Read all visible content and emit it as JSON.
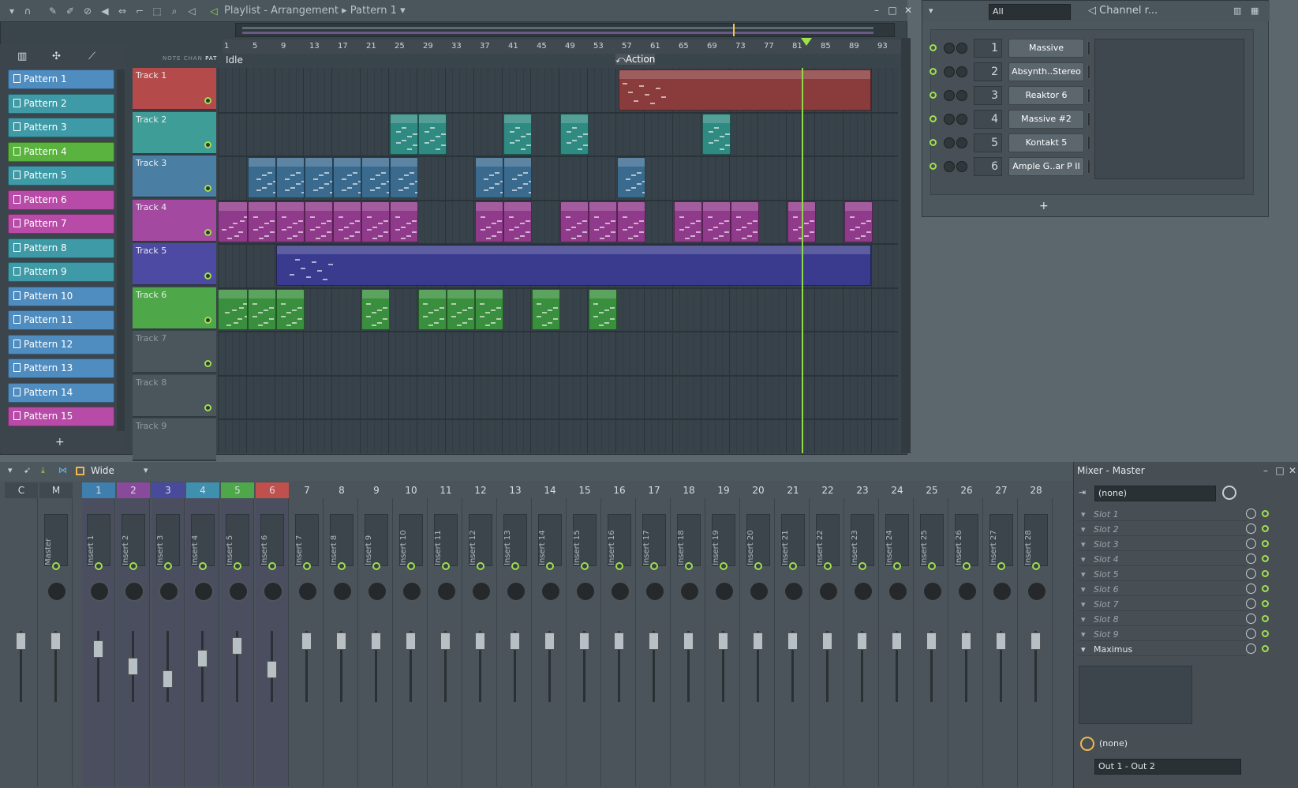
{
  "playlist": {
    "title": "Playlist - Arrangement",
    "pattern_selector": "Pattern 1",
    "status": "Idle",
    "marker": "Action",
    "ruler": [
      "1",
      "5",
      "9",
      "13",
      "17",
      "21",
      "25",
      "29",
      "33",
      "37",
      "41",
      "45",
      "49",
      "53",
      "57",
      "61",
      "65",
      "69",
      "73",
      "77",
      "81",
      "85",
      "89",
      "93"
    ],
    "panel_tabs": [
      "NOTE",
      "CHAN",
      "PAT"
    ],
    "patterns": [
      {
        "label": "Pattern 1",
        "color": "#4f8cc0"
      },
      {
        "label": "Pattern 2",
        "color": "#3d9aa6"
      },
      {
        "label": "Pattern 3",
        "color": "#3d9aa6"
      },
      {
        "label": "Pattern 4",
        "color": "#5ab33e"
      },
      {
        "label": "Pattern 5",
        "color": "#3d9aa6"
      },
      {
        "label": "Pattern 6",
        "color": "#b84aa8"
      },
      {
        "label": "Pattern 7",
        "color": "#b84aa8"
      },
      {
        "label": "Pattern 8",
        "color": "#3d9aa6"
      },
      {
        "label": "Pattern 9",
        "color": "#3d9aa6"
      },
      {
        "label": "Pattern 10",
        "color": "#4f8cc0"
      },
      {
        "label": "Pattern 11",
        "color": "#4f8cc0"
      },
      {
        "label": "Pattern 12",
        "color": "#4f8cc0"
      },
      {
        "label": "Pattern 13",
        "color": "#4f8cc0"
      },
      {
        "label": "Pattern 14",
        "color": "#4f8cc0"
      },
      {
        "label": "Pattern 15",
        "color": "#b84aa8"
      }
    ],
    "tracks": [
      {
        "label": "Track 1",
        "color": "#b44a4a"
      },
      {
        "label": "Track 2",
        "color": "#3f9d97"
      },
      {
        "label": "Track 3",
        "color": "#4a7ea3"
      },
      {
        "label": "Track 4",
        "color": "#a34aa0"
      },
      {
        "label": "Track 5",
        "color": "#4c4aa3"
      },
      {
        "label": "Track 6",
        "color": "#4ea84a"
      },
      {
        "label": "Track 7",
        "color": "#4b555c"
      },
      {
        "label": "Track 8",
        "color": "#4b555c"
      },
      {
        "label": "Track 9",
        "color": "#4b555c"
      }
    ]
  },
  "channel_rack": {
    "filter": "All",
    "title": "Channel r...",
    "channels": [
      {
        "num": "1",
        "name": "Massive"
      },
      {
        "num": "2",
        "name": "Absynth..Stereo"
      },
      {
        "num": "3",
        "name": "Reaktor 6"
      },
      {
        "num": "4",
        "name": "Massive #2"
      },
      {
        "num": "5",
        "name": "Kontakt 5"
      },
      {
        "num": "6",
        "name": "Ample G..ar P II"
      }
    ],
    "add": "+"
  },
  "mixer": {
    "mode": "Wide",
    "strips": [
      {
        "num": "C",
        "name": ""
      },
      {
        "num": "M",
        "name": "Master"
      },
      {
        "num": "1",
        "name": "Insert 1"
      },
      {
        "num": "2",
        "name": "Insert 2"
      },
      {
        "num": "3",
        "name": "Insert 3"
      },
      {
        "num": "4",
        "name": "Insert 4"
      },
      {
        "num": "5",
        "name": "Insert 5"
      },
      {
        "num": "6",
        "name": "Insert 6"
      },
      {
        "num": "7",
        "name": "Insert 7"
      },
      {
        "num": "8",
        "name": "Insert 8"
      },
      {
        "num": "9",
        "name": "Insert 9"
      },
      {
        "num": "10",
        "name": "Insert 10"
      },
      {
        "num": "11",
        "name": "Insert 11"
      },
      {
        "num": "12",
        "name": "Insert 12"
      },
      {
        "num": "13",
        "name": "Insert 13"
      },
      {
        "num": "14",
        "name": "Insert 14"
      },
      {
        "num": "15",
        "name": "Insert 15"
      },
      {
        "num": "16",
        "name": "Insert 16"
      },
      {
        "num": "17",
        "name": "Insert 17"
      },
      {
        "num": "18",
        "name": "Insert 18"
      },
      {
        "num": "19",
        "name": "Insert 19"
      },
      {
        "num": "20",
        "name": "Insert 20"
      },
      {
        "num": "21",
        "name": "Insert 21"
      },
      {
        "num": "22",
        "name": "Insert 22"
      },
      {
        "num": "23",
        "name": "Insert 23"
      },
      {
        "num": "24",
        "name": "Insert 24"
      },
      {
        "num": "25",
        "name": "Insert 25"
      },
      {
        "num": "26",
        "name": "Insert 26"
      },
      {
        "num": "27",
        "name": "Insert 27"
      },
      {
        "num": "28",
        "name": "Insert 28"
      }
    ],
    "master_panel": {
      "title": "Mixer - Master",
      "input": "(none)",
      "slots": [
        "Slot 1",
        "Slot 2",
        "Slot 3",
        "Slot 4",
        "Slot 5",
        "Slot 6",
        "Slot 7",
        "Slot 8",
        "Slot 9"
      ],
      "effect": "Maximus",
      "sidechain": "(none)",
      "output": "Out 1 - Out 2"
    }
  }
}
